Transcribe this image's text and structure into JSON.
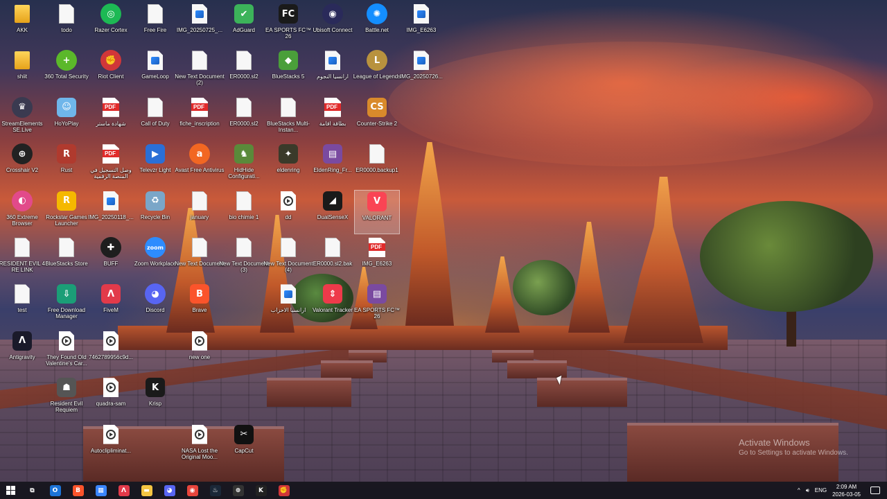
{
  "desktop": {
    "icons": [
      {
        "label": "AKK",
        "type": "folder",
        "col": 0,
        "row": 0
      },
      {
        "label": "todo",
        "type": "doc",
        "col": 1,
        "row": 0
      },
      {
        "label": "Razer Cortex",
        "type": "round",
        "color": "#1db954",
        "glyph": "◎",
        "col": 2,
        "row": 0
      },
      {
        "label": "Free Fire",
        "type": "doc",
        "col": 3,
        "row": 0
      },
      {
        "label": "IMG_20250725_...",
        "type": "img",
        "col": 4,
        "row": 0
      },
      {
        "label": "AdGuard",
        "type": "app",
        "color": "#3cb35a",
        "glyph": "✔",
        "col": 5,
        "row": 0
      },
      {
        "label": "EA SPORTS FC™ 26",
        "type": "app",
        "color": "#1a1a1a",
        "glyph": "FC",
        "col": 6,
        "row": 0
      },
      {
        "label": "Ubisoft Connect",
        "type": "round",
        "color": "#2a2a5a",
        "glyph": "◉",
        "col": 7,
        "row": 0
      },
      {
        "label": "Battle.net",
        "type": "round",
        "color": "#148eff",
        "glyph": "✺",
        "col": 8,
        "row": 0
      },
      {
        "label": "IMG_E6263",
        "type": "img",
        "col": 9,
        "row": 0
      },
      {
        "label": "shiit",
        "type": "folder",
        "col": 0,
        "row": 1
      },
      {
        "label": "360 Total Security",
        "type": "round",
        "color": "#5bb82a",
        "glyph": "+",
        "col": 1,
        "row": 1
      },
      {
        "label": "Riot Client",
        "type": "round",
        "color": "#d13639",
        "glyph": "✊",
        "col": 2,
        "row": 1
      },
      {
        "label": "GameLoop",
        "type": "img",
        "col": 3,
        "row": 1
      },
      {
        "label": "New Text Document (2)",
        "type": "doc",
        "col": 4,
        "row": 1
      },
      {
        "label": "ER0000.sl2",
        "type": "doc",
        "col": 5,
        "row": 1
      },
      {
        "label": "BlueStacks 5",
        "type": "app",
        "color": "#4a9f3a",
        "glyph": "◆",
        "col": 6,
        "row": 1
      },
      {
        "label": "ارانسیا النجوم",
        "type": "img",
        "col": 7,
        "row": 1
      },
      {
        "label": "League of Legends",
        "type": "round",
        "color": "#b8923e",
        "glyph": "L",
        "col": 8,
        "row": 1
      },
      {
        "label": "IMG_20250726...",
        "type": "img",
        "col": 9,
        "row": 1
      },
      {
        "label": "StreamElements SE.Live",
        "type": "round",
        "color": "#3a3a50",
        "glyph": "♛",
        "col": 0,
        "row": 2
      },
      {
        "label": "HoYoPlay",
        "type": "app",
        "color": "#6fb6ea",
        "glyph": "☺",
        "col": 1,
        "row": 2
      },
      {
        "label": "شهادة ماستر",
        "type": "pdf",
        "col": 2,
        "row": 2
      },
      {
        "label": "Call of Duty",
        "type": "doc",
        "col": 3,
        "row": 2
      },
      {
        "label": "fiche_inscription",
        "type": "pdf",
        "col": 4,
        "row": 2
      },
      {
        "label": "ER0000.sl2",
        "type": "doc",
        "col": 5,
        "row": 2
      },
      {
        "label": "BlueStacks Multi-Instan...",
        "type": "doc",
        "col": 6,
        "row": 2
      },
      {
        "label": "بطاقة اقامة",
        "type": "pdf",
        "col": 7,
        "row": 2
      },
      {
        "label": "Counter-Strike 2",
        "type": "app",
        "color": "#d98a2b",
        "glyph": "CS",
        "col": 8,
        "row": 2
      },
      {
        "label": "Crosshair V2",
        "type": "round",
        "color": "#222",
        "glyph": "⊕",
        "col": 0,
        "row": 3
      },
      {
        "label": "Rust",
        "type": "app",
        "color": "#b03a2e",
        "glyph": "R",
        "col": 1,
        "row": 3
      },
      {
        "label": "وصل التسجيل في المنصة الرقمية",
        "type": "pdf",
        "col": 2,
        "row": 3
      },
      {
        "label": "Televzr Light",
        "type": "app",
        "color": "#2a6fd6",
        "glyph": "▶",
        "col": 3,
        "row": 3
      },
      {
        "label": "Avast Free Antivirus",
        "type": "round",
        "color": "#f26722",
        "glyph": "a",
        "col": 4,
        "row": 3
      },
      {
        "label": "HidHide Configurati...",
        "type": "app",
        "color": "#5a8a3a",
        "glyph": "♞",
        "col": 5,
        "row": 3
      },
      {
        "label": "eldenring",
        "type": "app",
        "color": "#3a3a2a",
        "glyph": "✦",
        "col": 6,
        "row": 3
      },
      {
        "label": "EldenRing_Fr...",
        "type": "app",
        "color": "#7a4aa0",
        "glyph": "▤",
        "col": 7,
        "row": 3
      },
      {
        "label": "ER0000.backup1",
        "type": "doc",
        "col": 8,
        "row": 3
      },
      {
        "label": "360 Extreme Browser",
        "type": "round",
        "color": "#e24a8a",
        "glyph": "◐",
        "col": 0,
        "row": 4
      },
      {
        "label": "Rockstar Games Launcher",
        "type": "app",
        "color": "#f5b800",
        "glyph": "R",
        "col": 1,
        "row": 4
      },
      {
        "label": "IMG_20250118_...",
        "type": "img",
        "col": 2,
        "row": 4
      },
      {
        "label": "Recycle Bin",
        "type": "app",
        "color": "#7aa6c8",
        "glyph": "♻",
        "col": 3,
        "row": 4
      },
      {
        "label": "january",
        "type": "doc",
        "col": 4,
        "row": 4
      },
      {
        "label": "bio chimie 1",
        "type": "doc",
        "col": 5,
        "row": 4
      },
      {
        "label": "dd",
        "type": "video",
        "col": 6,
        "row": 4
      },
      {
        "label": "DualSenseX",
        "type": "app",
        "color": "#1a1a1a",
        "glyph": "◢",
        "col": 7,
        "row": 4
      },
      {
        "label": "VALORANT",
        "type": "app",
        "color": "#fa4454",
        "glyph": "V",
        "col": 8,
        "row": 4,
        "selected": true
      },
      {
        "label": "RESIDENT EVIL 4 RE LINK",
        "type": "doc",
        "col": 0,
        "row": 5
      },
      {
        "label": "BlueStacks Store",
        "type": "doc",
        "col": 1,
        "row": 5
      },
      {
        "label": "BUFF",
        "type": "round",
        "color": "#1e1e1e",
        "glyph": "✚",
        "col": 2,
        "row": 5
      },
      {
        "label": "Zoom Workplace",
        "type": "round",
        "color": "#2d8cff",
        "glyph": "zoom",
        "col": 3,
        "row": 5
      },
      {
        "label": "New Text Document",
        "type": "doc",
        "col": 4,
        "row": 5
      },
      {
        "label": "New Text Document (3)",
        "type": "doc",
        "col": 5,
        "row": 5
      },
      {
        "label": "New Text Document (4)",
        "type": "doc",
        "col": 6,
        "row": 5
      },
      {
        "label": "ER0000.sl2.bak",
        "type": "doc",
        "col": 7,
        "row": 5
      },
      {
        "label": "IMG_E6263",
        "type": "pdf",
        "col": 8,
        "row": 5
      },
      {
        "label": "test",
        "type": "doc",
        "col": 0,
        "row": 6
      },
      {
        "label": "Free Download Manager",
        "type": "app",
        "color": "#1b9e77",
        "glyph": "⇩",
        "col": 1,
        "row": 6
      },
      {
        "label": "FiveM",
        "type": "app",
        "color": "#e23a4a",
        "glyph": "Λ",
        "col": 2,
        "row": 6
      },
      {
        "label": "Discord",
        "type": "round",
        "color": "#5865f2",
        "glyph": "◕",
        "col": 3,
        "row": 6
      },
      {
        "label": "Brave",
        "type": "app",
        "color": "#fb542b",
        "glyph": "B",
        "col": 4,
        "row": 6
      },
      {
        "label": "ارانسيا الاحزاب",
        "type": "img",
        "col": 6,
        "row": 6
      },
      {
        "label": "Valorant Tracker",
        "type": "app",
        "color": "#ee3a4a",
        "glyph": "⇕",
        "col": 7,
        "row": 6
      },
      {
        "label": "EA SPORTS FC™ 26",
        "type": "app",
        "color": "#7a4aa0",
        "glyph": "▤",
        "col": 8,
        "row": 6
      },
      {
        "label": "Antigravity",
        "type": "app",
        "color": "#1a1a2a",
        "glyph": "Λ",
        "col": 0,
        "row": 7
      },
      {
        "label": "They Found Old Valentine's Car...",
        "type": "video",
        "col": 1,
        "row": 7
      },
      {
        "label": "7462789956c9d...",
        "type": "video",
        "col": 2,
        "row": 7
      },
      {
        "label": "new one",
        "type": "video",
        "col": 4,
        "row": 7
      },
      {
        "label": "Resident Evil Requiem",
        "type": "app",
        "color": "#555",
        "glyph": "☗",
        "col": 1,
        "row": 8
      },
      {
        "label": "quadra-sam",
        "type": "video",
        "col": 2,
        "row": 8
      },
      {
        "label": "Krisp",
        "type": "app",
        "color": "#1a1a1a",
        "glyph": "K",
        "col": 3,
        "row": 8
      },
      {
        "label": "Autoclipliminat...",
        "type": "video",
        "col": 2,
        "row": 9
      },
      {
        "label": "NASA Lost the Original Moo...",
        "type": "video",
        "col": 4,
        "row": 9
      },
      {
        "label": "CapCut",
        "type": "app",
        "color": "#111",
        "glyph": "✂",
        "col": 5,
        "row": 9
      }
    ]
  },
  "watermark": {
    "line1": "Activate Windows",
    "line2": "Go to Settings to activate Windows."
  },
  "taskbar": {
    "apps": [
      {
        "name": "start-button",
        "icon": "windows-start-icon",
        "color": "#ffffff"
      },
      {
        "name": "task-view-button",
        "icon": "task-view-icon",
        "color": "#ffffff",
        "glyph": "⧉"
      },
      {
        "name": "taskbar-outlook",
        "icon": "outlook-icon",
        "color": "#1c74d8",
        "glyph": "O"
      },
      {
        "name": "taskbar-brave",
        "icon": "brave-icon",
        "color": "#fb542b",
        "glyph": "B"
      },
      {
        "name": "taskbar-store",
        "icon": "store-icon",
        "color": "#3a86ff",
        "glyph": "▦"
      },
      {
        "name": "taskbar-fivem",
        "icon": "fivem-icon",
        "color": "#e23a4a",
        "glyph": "Λ"
      },
      {
        "name": "taskbar-explorer",
        "icon": "folder-icon",
        "color": "#f4c542",
        "glyph": "▬"
      },
      {
        "name": "taskbar-discord",
        "icon": "discord-icon",
        "color": "#5865f2",
        "glyph": "◕"
      },
      {
        "name": "taskbar-chrome",
        "icon": "chrome-icon",
        "color": "#e8453c",
        "glyph": "◉"
      },
      {
        "name": "taskbar-steam",
        "icon": "steam-icon",
        "color": "#1b2838",
        "glyph": "♨"
      },
      {
        "name": "taskbar-crosshair",
        "icon": "crosshair-icon",
        "color": "#333",
        "glyph": "⊕"
      },
      {
        "name": "taskbar-krisp",
        "icon": "krisp-icon",
        "color": "#222",
        "glyph": "K"
      },
      {
        "name": "taskbar-riot",
        "icon": "riot-icon",
        "color": "#d13639",
        "glyph": "✊"
      }
    ],
    "tray": {
      "chevron": "^",
      "language": "ENG",
      "time": "2:09 AM",
      "date": "2026-03-05"
    }
  }
}
